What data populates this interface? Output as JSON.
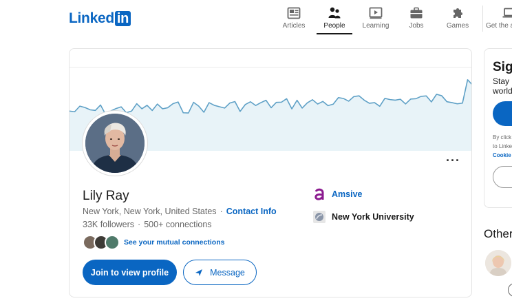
{
  "brand": {
    "logo_text": "Linked",
    "logo_box": "in",
    "color": "#0a66c2"
  },
  "nav": {
    "items": [
      {
        "label": "Articles",
        "icon": "articles-icon"
      },
      {
        "label": "People",
        "icon": "people-icon",
        "active": true
      },
      {
        "label": "Learning",
        "icon": "learning-icon"
      },
      {
        "label": "Jobs",
        "icon": "jobs-icon"
      },
      {
        "label": "Games",
        "icon": "games-icon"
      },
      {
        "label": "Get the app",
        "icon": "laptop-icon"
      }
    ]
  },
  "profile": {
    "name": "Lily Ray",
    "location": "New York, New York, United States",
    "separator": "·",
    "contact_info": "Contact Info",
    "followers": "33K followers",
    "connections": "500+ connections",
    "mutual": "See your mutual connections",
    "join_button": "Join to view profile",
    "message_button": "Message",
    "more_menu": "···",
    "organizations": [
      {
        "name": "Amsive",
        "icon": "amsive-logo"
      },
      {
        "name": "New York University",
        "icon": "nyu-logo"
      }
    ]
  },
  "sidebar": {
    "title": "Sign",
    "subtitle": "Stay u\nworld",
    "legal": "By click\nto Linke\n",
    "legal_link": "Cookie",
    "others_heading": "Other"
  },
  "colors": {
    "accent": "#0a66c2",
    "banner_fill": "#e8f3f8",
    "banner_line": "#5ea0c6",
    "amsive": "#8b1a8f"
  }
}
